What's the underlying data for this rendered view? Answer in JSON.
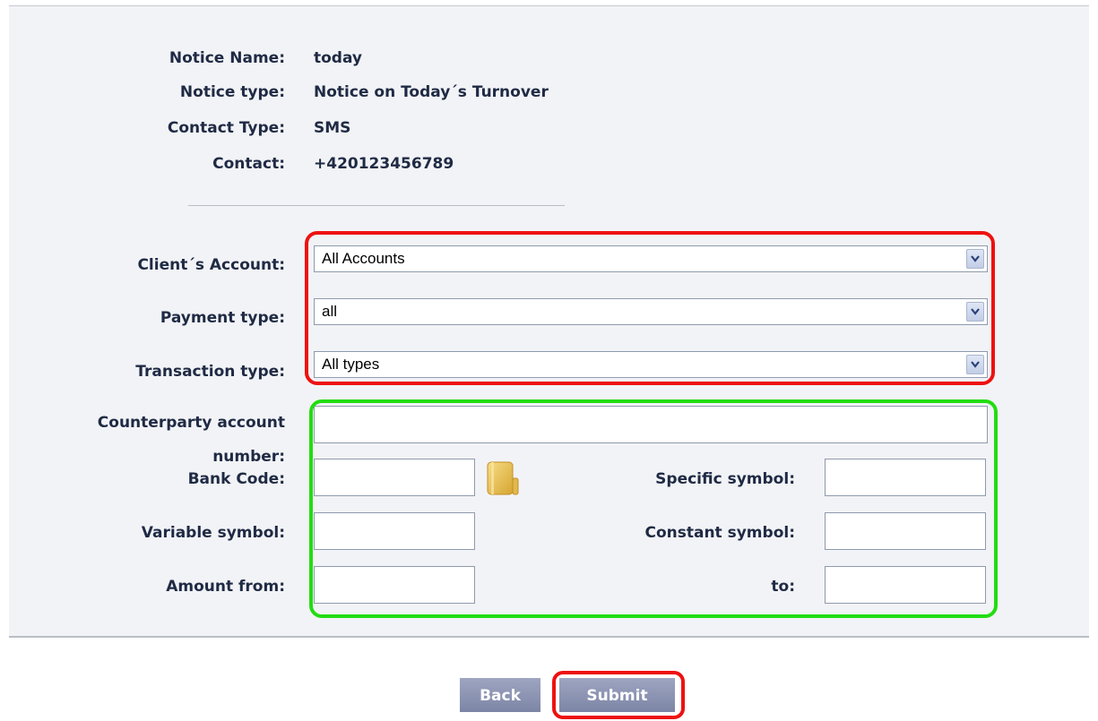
{
  "notice": {
    "name_label": "Notice Name:",
    "name_value": "today",
    "type_label": "Notice type:",
    "type_value": "Notice on Today´s Turnover",
    "contact_type_label": "Contact Type:",
    "contact_type_value": "SMS",
    "contact_label": "Contact:",
    "contact_value": "+420123456789"
  },
  "filters": {
    "client_account_label": "Client´s Account:",
    "client_account_value": "All Accounts",
    "payment_type_label": "Payment type:",
    "payment_type_value": "all",
    "transaction_type_label": "Transaction type:",
    "transaction_type_value": "All types"
  },
  "fields": {
    "counterparty_label_line1": "Counterparty account",
    "counterparty_label_line2": "number:",
    "bank_code_label": "Bank Code:",
    "specific_symbol_label": "Specific symbol:",
    "variable_symbol_label": "Variable symbol:",
    "constant_symbol_label": "Constant symbol:",
    "amount_from_label": "Amount from:",
    "amount_to_label": "to:",
    "counterparty_value": "",
    "bank_code_value": "",
    "specific_symbol_value": "",
    "variable_symbol_value": "",
    "constant_symbol_value": "",
    "amount_from_value": "",
    "amount_to_value": ""
  },
  "buttons": {
    "back_label": "Back",
    "submit_label": "Submit"
  },
  "icons": {
    "bank_code_lookup": "address-book-icon",
    "dropdown": "chevron-down-icon"
  },
  "colors": {
    "highlight_red": "#ee1111",
    "highlight_green": "#22dd11",
    "button_bg": "#8a91b0",
    "text": "#1f2a44",
    "panel_bg": "#f2f3f6"
  }
}
